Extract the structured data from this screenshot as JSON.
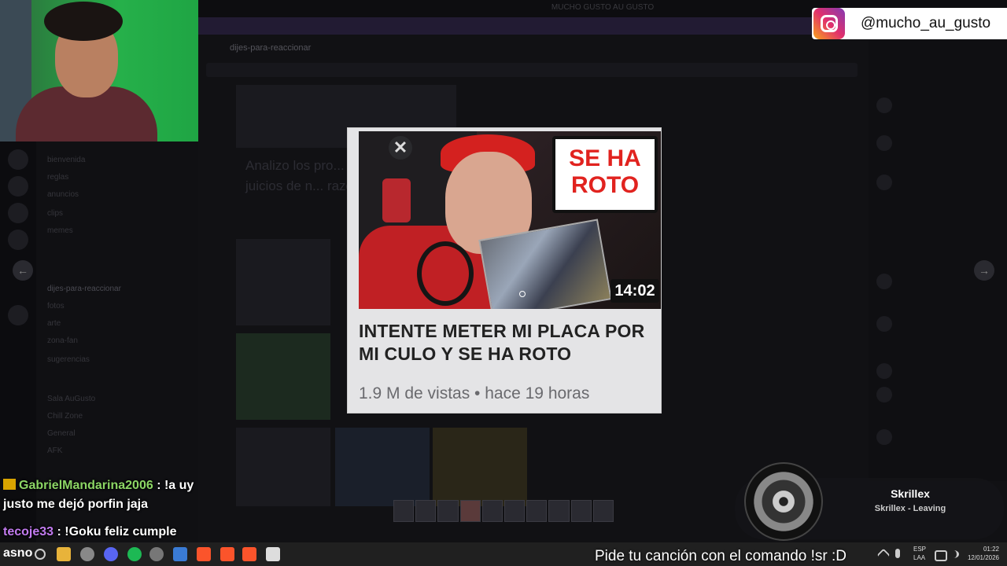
{
  "window": {
    "title": "MUCHO GUSTO AU GUSTO"
  },
  "discord": {
    "channel": "dijes-para-reaccionar",
    "post_title": "Analizo los pro... los juicios de n... razón?",
    "channels": [
      "bienvenida",
      "reglas",
      "anuncios",
      "clips",
      "memes",
      "dijes-para-reaccionar",
      "fotos",
      "arte",
      "zona-fan",
      "sugerencias"
    ],
    "voice_categories": [
      "Sala AuGusto",
      "Chill Zone",
      "General",
      "AFK"
    ]
  },
  "lightbox": {
    "bubble_text": "SE HA ROTO",
    "duration": "14:02",
    "video_title": "INTENTE METER MI PLACA POR MI CULO Y SE HA ROTO",
    "video_meta": "1.9 M de vistas • hace 19 horas",
    "prev_icon": "←",
    "next_icon": "→"
  },
  "instagram": {
    "handle": "@mucho_au_gusto"
  },
  "chat": [
    {
      "user": "GabrielMandarina2006",
      "message": ": !a uy justo me dejó porfin jaja"
    },
    {
      "user": "tecoje33",
      "message": ": !Goku feliz cumple"
    }
  ],
  "music": {
    "artist": "Skrillex",
    "track": "Skrillex - Leaving"
  },
  "taskbar": {
    "label": "asno",
    "ticker": "Pide tu canción con el comando !sr :D",
    "lang_top": "ESP",
    "lang_bottom": "LAA",
    "time": "01:22",
    "date": "12/01/2026"
  },
  "colors": {
    "chat_user1": "#8cd665",
    "chat_user2": "#c27bf0",
    "bubble_red": "#e1231f"
  }
}
